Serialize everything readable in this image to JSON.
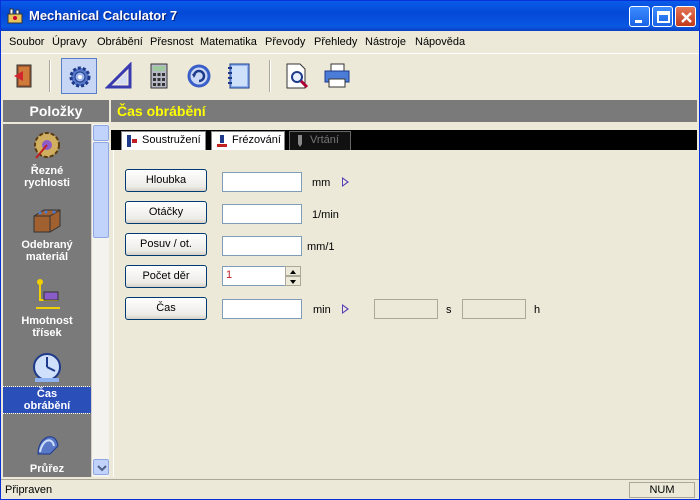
{
  "window": {
    "title": "Mechanical Calculator 7"
  },
  "menu": [
    "Soubor",
    "Úpravy",
    "Obrábění",
    "Přesnost",
    "Matematika",
    "Převody",
    "Přehledy",
    "Nástroje",
    "Nápověda"
  ],
  "toolbar": {
    "icons": [
      "exit-icon",
      "settings-gear-icon",
      "triangle-icon",
      "calculator-icon",
      "refresh-icon",
      "notebook-icon",
      "print-preview-icon",
      "printer-icon"
    ],
    "active": "settings-gear-icon"
  },
  "left_panel": {
    "header": "Položky",
    "items": [
      {
        "label1": "Řezné",
        "label2": "rychlosti"
      },
      {
        "label1": "Odebraný",
        "label2": "materiál"
      },
      {
        "label1": "Hmotnost",
        "label2": "třísek"
      },
      {
        "label1": "Čas",
        "label2": "obrábění"
      },
      {
        "label1": "Průřez",
        "label2": ""
      }
    ],
    "selected_index": 3
  },
  "main": {
    "header": "Čas obrábění",
    "tabs": [
      {
        "label": "Soustružení",
        "enabled": true
      },
      {
        "label": "Frézování",
        "enabled": true
      },
      {
        "label": "Vrtání",
        "enabled": false
      }
    ],
    "form": {
      "hloubka": {
        "label": "Hloubka",
        "value": "",
        "unit": "mm"
      },
      "otacky": {
        "label": "Otáčky",
        "value": "",
        "unit": "1/min"
      },
      "posuv": {
        "label": "Posuv / ot.",
        "value": "",
        "unit": "mm/1"
      },
      "pocet_der": {
        "label": "Počet děr",
        "value": "1"
      },
      "cas": {
        "label": "Čas",
        "value": "",
        "unit_min": "min",
        "seconds_value": "",
        "unit_s": "s",
        "hours_value": "",
        "unit_h": "h"
      }
    }
  },
  "status": {
    "text": "Připraven",
    "num": "NUM"
  },
  "colors": {
    "panel_gray": "#7a7a7a",
    "header_yellow": "#ffff00",
    "title_blue": "#0a5ce9",
    "selected_blue": "#2b4fb9"
  }
}
